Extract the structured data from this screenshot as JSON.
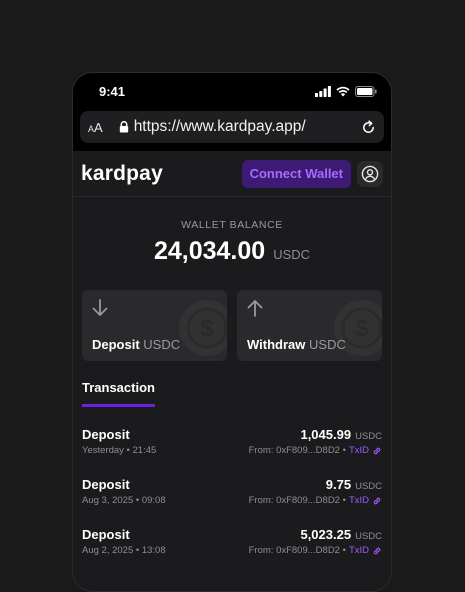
{
  "status_bar": {
    "time": "9:41"
  },
  "browser": {
    "aa_small": "A",
    "aa_large": "A",
    "url": "https://www.kardpay.app/"
  },
  "header": {
    "logo": "kardpay",
    "connect_label": "Connect Wallet"
  },
  "balance": {
    "label": "WALLET BALANCE",
    "amount": "24,034.00",
    "unit": "USDC"
  },
  "actions": [
    {
      "label": "Deposit",
      "unit": "USDC"
    },
    {
      "label": "Withdraw",
      "unit": "USDC"
    }
  ],
  "tabs": [
    {
      "label": "Transaction"
    }
  ],
  "transactions": [
    {
      "type": "Deposit",
      "date": "Yesterday • 21:45",
      "amount": "1,045.99",
      "unit": "USDC",
      "from": "From: 0xF809...D8D2 •",
      "txid": "TxID"
    },
    {
      "type": "Deposit",
      "date": "Aug 3, 2025 • 09:08",
      "amount": "9.75",
      "unit": "USDC",
      "from": "From: 0xF809...D8D2 •",
      "txid": "TxID"
    },
    {
      "type": "Deposit",
      "date": "Aug 2, 2025 • 13:08",
      "amount": "5,023.25",
      "unit": "USDC",
      "from": "From: 0xF809...D8D2 •",
      "txid": "TxID"
    }
  ],
  "colors": {
    "accent": "#6a24e0",
    "accent_text": "#a76bff",
    "background": "#1b1b1d"
  }
}
